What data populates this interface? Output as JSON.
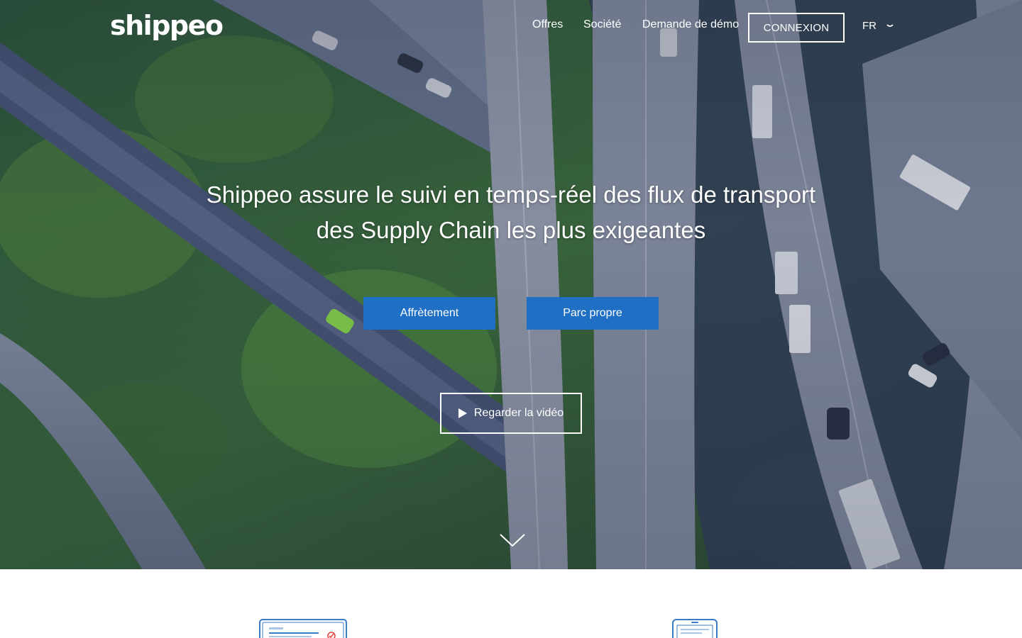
{
  "brand": {
    "logo_text": "shippeo"
  },
  "nav": {
    "items": [
      {
        "label": "Offres"
      },
      {
        "label": "Société"
      },
      {
        "label": "Demande de démo"
      }
    ],
    "login_label": "CONNEXION",
    "language": "FR"
  },
  "hero": {
    "headline_line1": "Shippeo assure le suivi en temps-réel des flux de transport",
    "headline_line2": "des Supply Chain les plus exigeantes",
    "buttons": [
      {
        "label": "Affrètement"
      },
      {
        "label": "Parc propre"
      }
    ],
    "video_label": "Regarder la vidéo",
    "background": "aerial-highway-photo"
  },
  "colors": {
    "accent": "#1f6fc5",
    "text_on_hero": "#ffffff",
    "illustration_blue": "#3a7bc8",
    "illustration_red": "#e0423a"
  },
  "icons": {
    "play": "play-icon",
    "scroll": "chevron-down-icon",
    "language": "chevron-down-icon"
  }
}
